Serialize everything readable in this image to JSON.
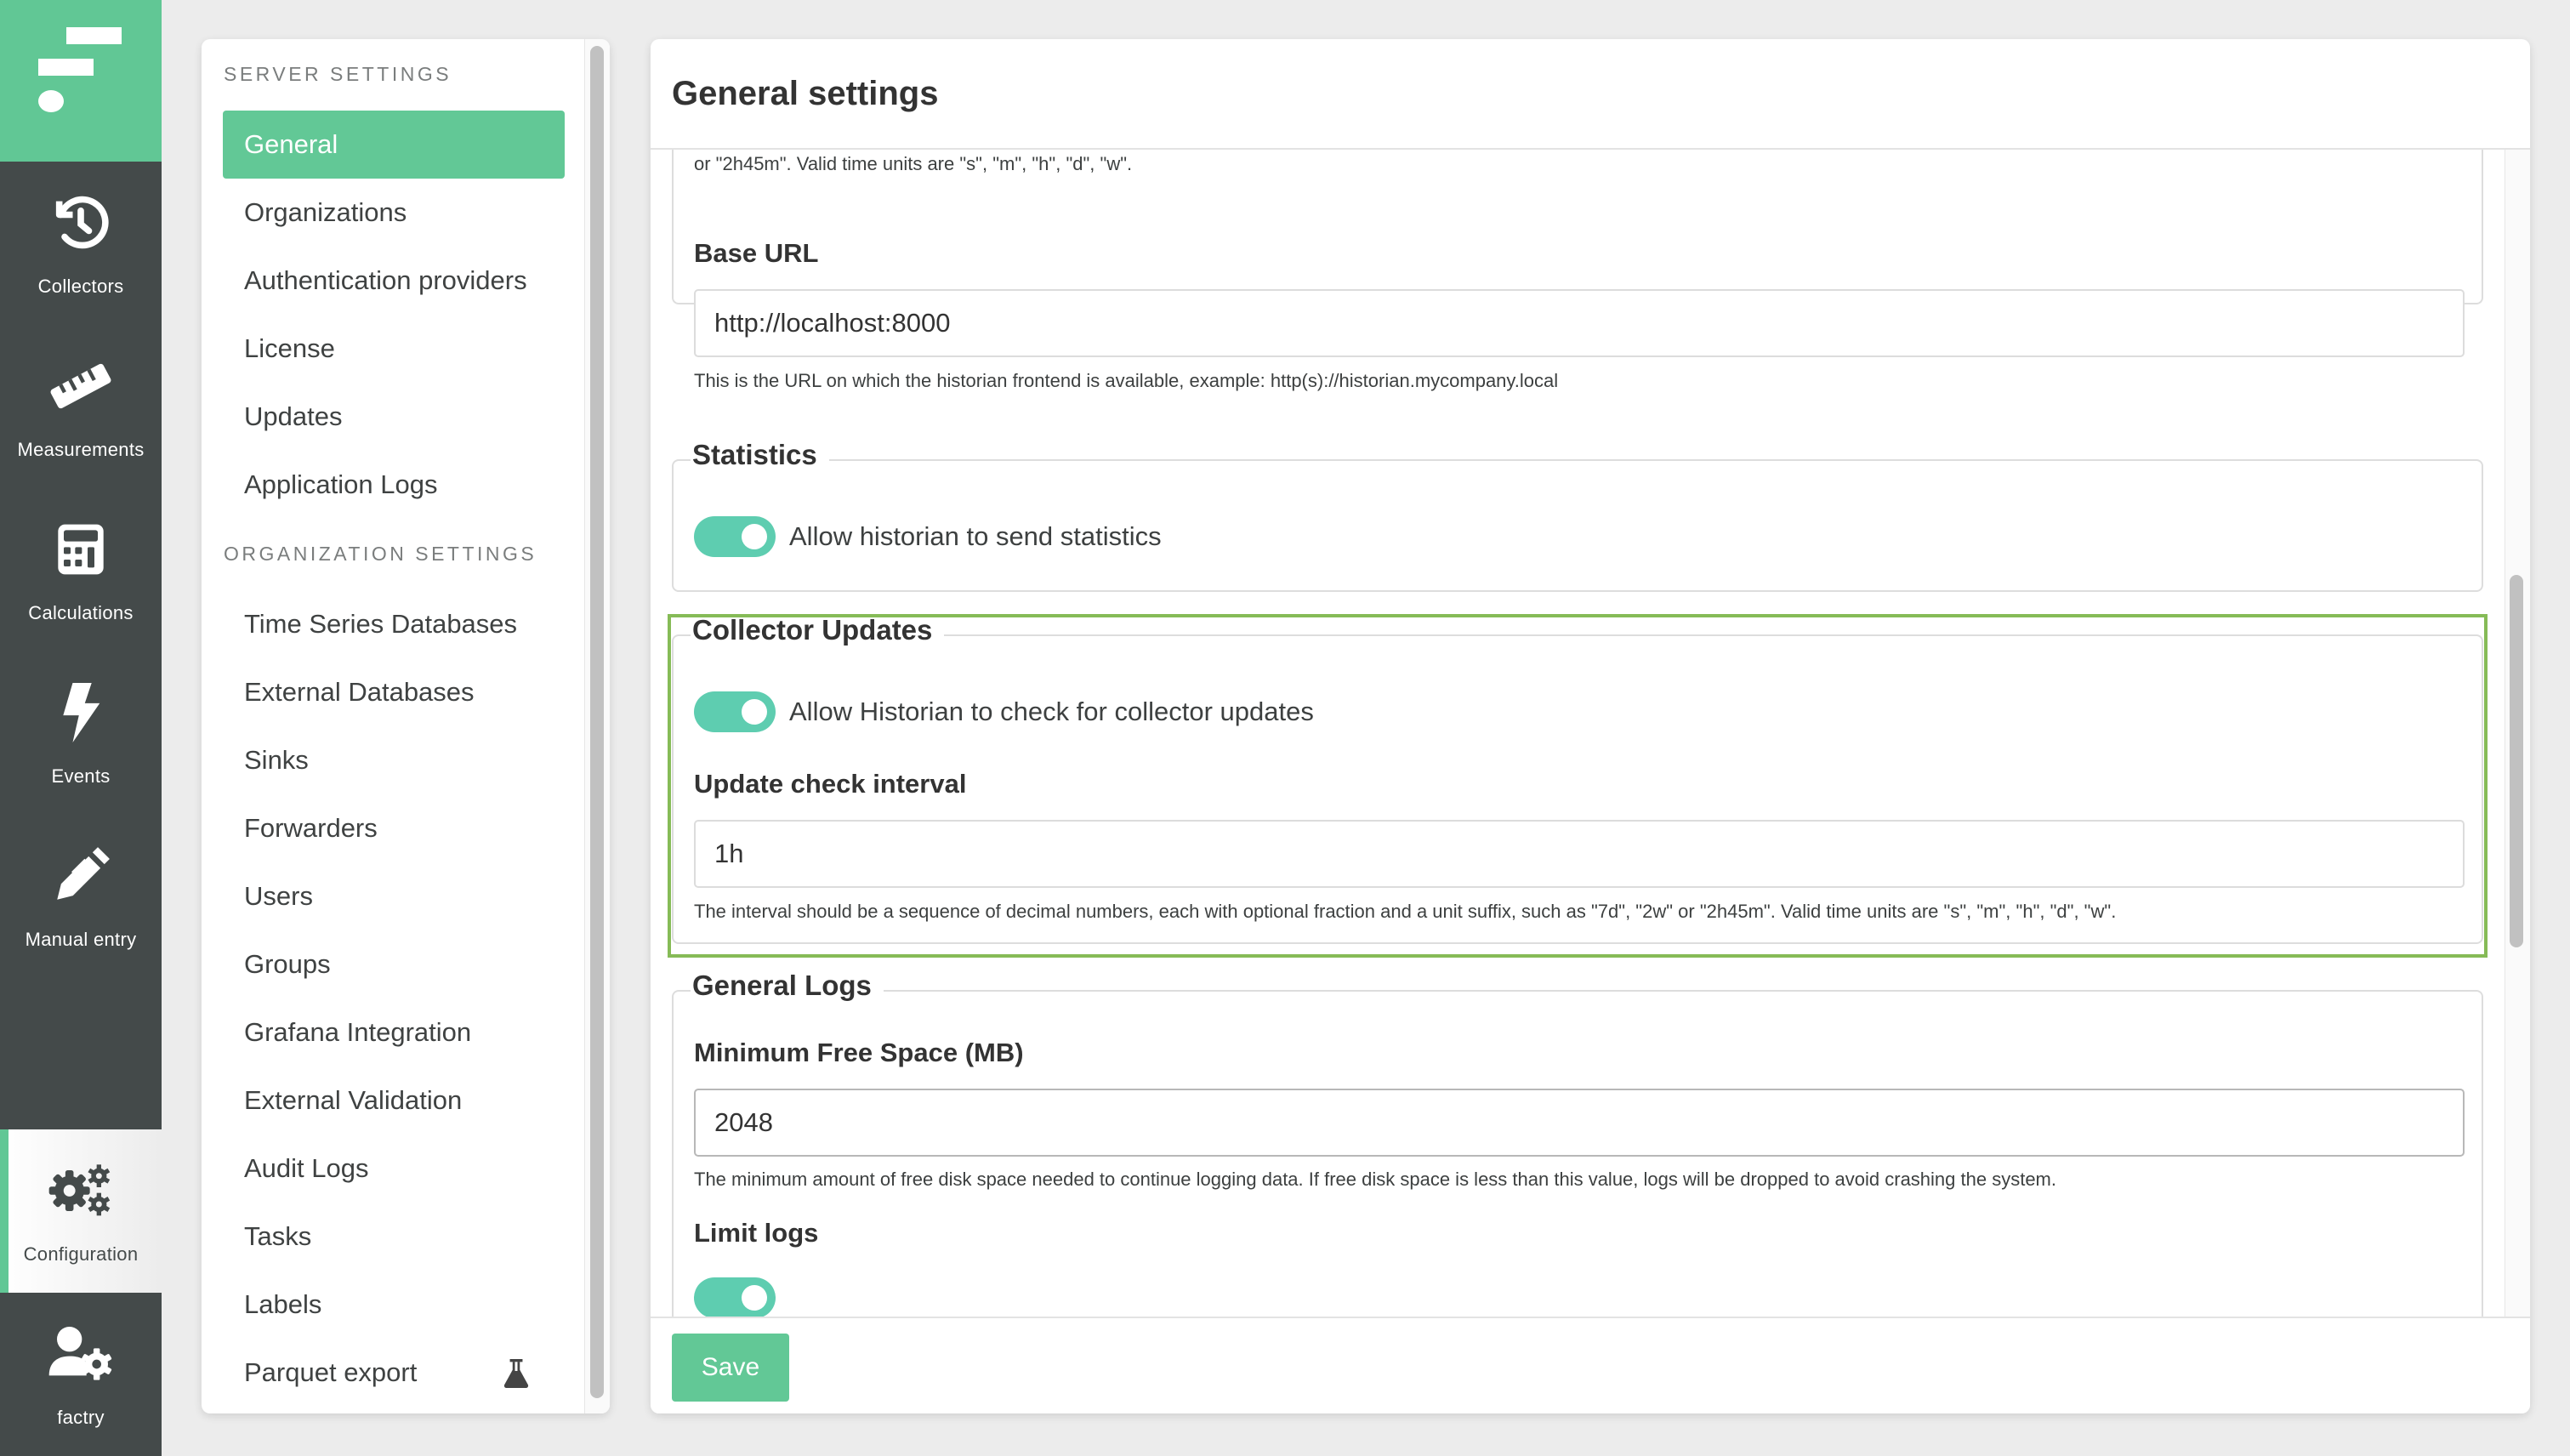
{
  "rail": {
    "logo": "factry-logo",
    "items": [
      {
        "label": "Collectors",
        "icon": "history-icon",
        "active": false
      },
      {
        "label": "Measurements",
        "icon": "ruler-icon",
        "active": false
      },
      {
        "label": "Calculations",
        "icon": "calculator-icon",
        "active": false
      },
      {
        "label": "Events",
        "icon": "bolt-icon",
        "active": false
      },
      {
        "label": "Manual entry",
        "icon": "pen-icon",
        "active": false
      },
      {
        "label": "Configuration",
        "icon": "gears-icon",
        "active": true
      },
      {
        "label": "factry",
        "icon": "user-gear-icon",
        "active": false
      }
    ]
  },
  "nav": {
    "server_section": "Server Settings",
    "server_items": [
      {
        "label": "General",
        "active": true
      },
      {
        "label": "Organizations"
      },
      {
        "label": "Authentication providers"
      },
      {
        "label": "License"
      },
      {
        "label": "Updates"
      },
      {
        "label": "Application Logs"
      }
    ],
    "org_section": "Organization Settings",
    "org_items": [
      {
        "label": "Time Series Databases"
      },
      {
        "label": "External Databases"
      },
      {
        "label": "Sinks"
      },
      {
        "label": "Forwarders"
      },
      {
        "label": "Users"
      },
      {
        "label": "Groups"
      },
      {
        "label": "Grafana Integration"
      },
      {
        "label": "External Validation"
      },
      {
        "label": "Audit Logs"
      },
      {
        "label": "Tasks"
      },
      {
        "label": "Labels"
      },
      {
        "label": "Parquet export",
        "badge_icon": "flask-icon"
      }
    ]
  },
  "main": {
    "title": "General settings",
    "truncated_help": "or \"2h45m\". Valid time units are \"s\", \"m\", \"h\", \"d\", \"w\".",
    "base_url": {
      "label": "Base URL",
      "value": "http://localhost:8000",
      "help": "This is the URL on which the historian frontend is available, example: http(s)://historian.mycompany.local"
    },
    "statistics": {
      "legend": "Statistics",
      "toggle_label": "Allow historian to send statistics",
      "enabled": true
    },
    "collector_updates": {
      "legend": "Collector Updates",
      "toggle_label": "Allow Historian to check for collector updates",
      "enabled": true,
      "interval_label": "Update check interval",
      "interval_value": "1h",
      "interval_help": "The interval should be a sequence of decimal numbers, each with optional fraction and a unit suffix, such as \"7d\", \"2w\" or \"2h45m\". Valid time units are \"s\", \"m\", \"h\", \"d\", \"w\"."
    },
    "general_logs": {
      "legend": "General Logs",
      "min_free_label": "Minimum Free Space (MB)",
      "min_free_value": "2048",
      "min_free_help": "The minimum amount of free disk space needed to continue logging data. If free disk space is less than this value, logs will be dropped to avoid crashing the system.",
      "limit_logs_label": "Limit logs",
      "limit_logs_enabled": true
    },
    "save_label": "Save"
  },
  "colors": {
    "brand_green": "#61c795",
    "toggle_teal": "#5ecdb0",
    "rail_dark": "#444a4a",
    "highlight_green": "#86bb57"
  }
}
